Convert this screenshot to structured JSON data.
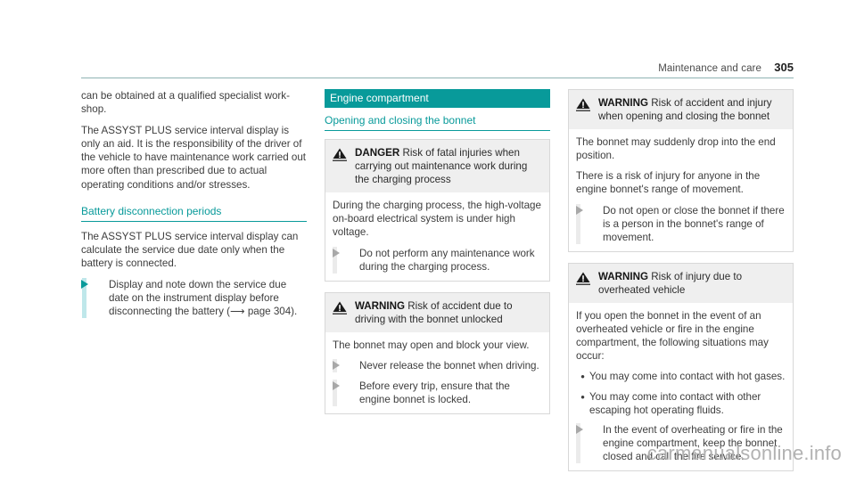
{
  "header": {
    "title": "Maintenance and care",
    "page_number": "305",
    "rule_color": "#8fb3b3"
  },
  "theme": {
    "accent_teal": "#089a9a",
    "accent_light_teal": "#bfe7ea",
    "box_header_gray": "#efefef",
    "box_border_gray": "#d8d8d8",
    "text_gray": "#3d3d3d",
    "watermark_gray": "#b2b2b2"
  },
  "left_column": {
    "paragraphs": [
      "can be obtained at a qualified specialist work-shop.",
      "The ASSYST PLUS service interval display is only an aid. It is the responsibility of the driver of the vehicle to have maintenance work carried out more often than prescribed due to actual operating conditions and/or stresses."
    ],
    "subheading": "Battery disconnection periods",
    "paragraph_2": "The ASSYST PLUS service interval display can calculate the service due date only when the battery is connected.",
    "action": "Display and note down the service due date on the instrument display before disconnecting the battery (⟶ page 304)."
  },
  "middle_column": {
    "section_bar": "Engine compartment",
    "subheading": "Opening and closing the bonnet",
    "boxes": [
      {
        "icon": "warning-triangle-icon",
        "level": "DANGER",
        "title": "Risk of fatal injuries when carrying out maintenance work during the charging process",
        "paragraphs": [
          "During the charging process, the high-voltage on-board electrical system is under high voltage."
        ],
        "actions": [
          "Do not perform any maintenance work during the charging process."
        ]
      },
      {
        "icon": "warning-triangle-icon",
        "level": "WARNING",
        "title": "Risk of accident due to driving with the bonnet unlocked",
        "paragraphs": [
          "The bonnet may open and block your view."
        ],
        "actions": [
          "Never release the bonnet when driving.",
          "Before every trip, ensure that the engine bonnet is locked."
        ]
      }
    ]
  },
  "right_column": {
    "boxes": [
      {
        "icon": "warning-triangle-icon",
        "level": "WARNING",
        "title": "Risk of accident and injury when opening and closing the bonnet",
        "paragraphs": [
          "The bonnet may suddenly drop into the end position.",
          "There is a risk of injury for anyone in the engine bonnet's range of movement."
        ],
        "actions": [
          "Do not open or close the bonnet if there is a person in the bonnet's range of movement."
        ]
      },
      {
        "icon": "warning-triangle-icon",
        "level": "WARNING",
        "title": "Risk of injury due to overheated vehicle",
        "paragraphs": [
          "If you open the bonnet in the event of an overheated vehicle or fire in the engine compartment, the following situations may occur:"
        ],
        "bullets": [
          "You may come into contact with hot gases.",
          "You may come into contact with other escaping hot operating fluids."
        ],
        "actions": [
          "In the event of overheating or fire in the engine compartment, keep the bonnet closed and call the fire service."
        ]
      }
    ]
  },
  "watermark": "carmanualsonline.info"
}
